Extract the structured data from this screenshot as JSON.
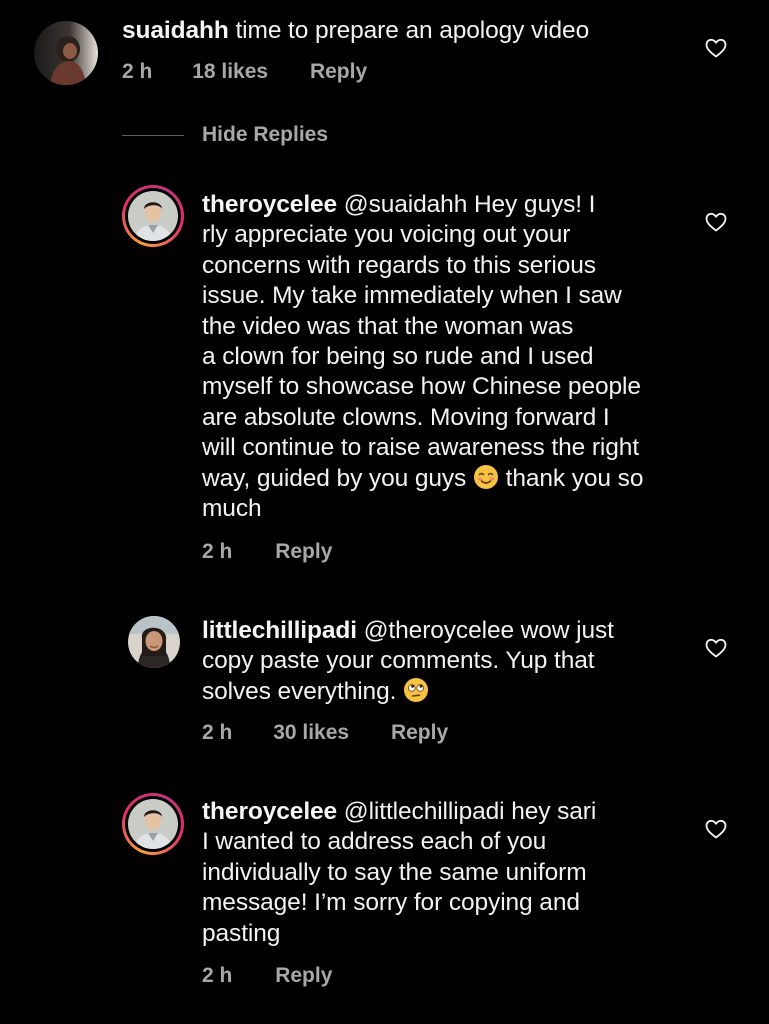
{
  "colors": {
    "background": "#000000",
    "text": "#f2f2f2",
    "meta": "#a8a8a8",
    "story_ring": [
      "#f9a13a",
      "#e1306c",
      "#c13584"
    ]
  },
  "comments": [
    {
      "username": "suaidahh",
      "body": " time to prepare an apology video",
      "time": "2 h",
      "likes": "18 likes",
      "reply": "Reply",
      "heart_icon": "heart-outline-icon"
    },
    {
      "username": "theroycelee",
      "mention": " @suaidahh",
      "body_lines": [
        " Hey guys! I",
        "rly appreciate you voicing out your",
        "concerns with regards to this serious",
        "issue. My take immediately when I saw",
        "the video was that the woman was",
        "a clown for being so rude and I used",
        "myself to showcase how Chinese people",
        "are absolute clowns. Moving forward I",
        "will continue to raise awareness the right",
        "way, guided by you guys ",
        " thank you so",
        "much"
      ],
      "emoji_icon": "smiling-blush-emoji-icon",
      "time": "2 h",
      "reply": "Reply",
      "heart_icon": "heart-outline-icon"
    },
    {
      "username": "littlechillipadi",
      "mention": " @theroycelee",
      "body_lines": [
        " wow just",
        "copy paste your comments. Yup that",
        "solves everything. "
      ],
      "emoji_icon": "eye-roll-emoji-icon",
      "time": "2 h",
      "likes": "30 likes",
      "reply": "Reply",
      "heart_icon": "heart-outline-icon"
    },
    {
      "username": "theroycelee",
      "mention": " @littlechillipadi",
      "body_lines": [
        " hey sari",
        "I wanted to address each of you",
        "individually to say the same uniform",
        "message! I’m sorry for copying and",
        "pasting"
      ],
      "time": "2 h",
      "reply": "Reply",
      "heart_icon": "heart-outline-icon"
    }
  ],
  "hide_replies": "Hide Replies"
}
